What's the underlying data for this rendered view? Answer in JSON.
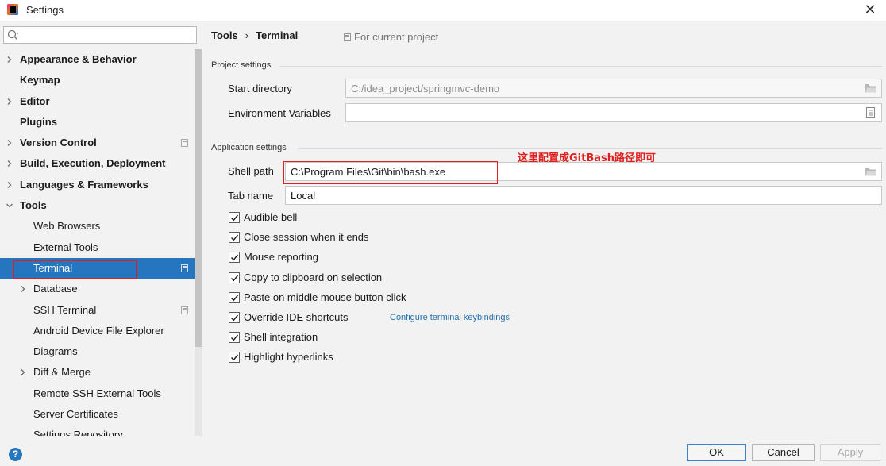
{
  "window": {
    "title": "Settings",
    "close_glyph": "✕"
  },
  "search": {
    "placeholder": "",
    "value": ""
  },
  "sidebar": {
    "items": [
      {
        "label": "Appearance & Behavior",
        "level": 0,
        "chevron": "right"
      },
      {
        "label": "Keymap",
        "level": 0,
        "chevron": "none"
      },
      {
        "label": "Editor",
        "level": 0,
        "chevron": "right"
      },
      {
        "label": "Plugins",
        "level": 0,
        "chevron": "none"
      },
      {
        "label": "Version Control",
        "level": 0,
        "chevron": "right",
        "project_icon": true
      },
      {
        "label": "Build, Execution, Deployment",
        "level": 0,
        "chevron": "right"
      },
      {
        "label": "Languages & Frameworks",
        "level": 0,
        "chevron": "right"
      },
      {
        "label": "Tools",
        "level": 0,
        "chevron": "down"
      },
      {
        "label": "Web Browsers",
        "level": 1,
        "chevron": "none"
      },
      {
        "label": "External Tools",
        "level": 1,
        "chevron": "none"
      },
      {
        "label": "Terminal",
        "level": 1,
        "chevron": "none",
        "selected": true,
        "project_icon": true
      },
      {
        "label": "Database",
        "level": 1,
        "chevron": "right"
      },
      {
        "label": "SSH Terminal",
        "level": 1,
        "chevron": "none",
        "project_icon": true
      },
      {
        "label": "Android Device File Explorer",
        "level": 1,
        "chevron": "none"
      },
      {
        "label": "Diagrams",
        "level": 1,
        "chevron": "none"
      },
      {
        "label": "Diff & Merge",
        "level": 1,
        "chevron": "right"
      },
      {
        "label": "Remote SSH External Tools",
        "level": 1,
        "chevron": "none"
      },
      {
        "label": "Server Certificates",
        "level": 1,
        "chevron": "none"
      },
      {
        "label": "Settings Repository",
        "level": 1,
        "chevron": "none"
      }
    ]
  },
  "breadcrumb": {
    "parent": "Tools",
    "separator": "›",
    "current": "Terminal"
  },
  "scope": {
    "label": "For current project"
  },
  "project_settings": {
    "title": "Project settings",
    "start_directory": {
      "label": "Start directory",
      "value": "C:/idea_project/springmvc-demo"
    },
    "env_vars": {
      "label": "Environment Variables",
      "value": ""
    }
  },
  "application_settings": {
    "title": "Application settings",
    "annotation": "这里配置成GitBash路径即可",
    "shell_path": {
      "label": "Shell path",
      "value": "C:\\Program Files\\Git\\bin\\bash.exe"
    },
    "tab_name": {
      "label": "Tab name",
      "value": "Local"
    },
    "checkboxes": [
      {
        "label": "Audible bell",
        "checked": true
      },
      {
        "label": "Close session when it ends",
        "checked": true
      },
      {
        "label": "Mouse reporting",
        "checked": true
      },
      {
        "label": "Copy to clipboard on selection",
        "checked": true
      },
      {
        "label": "Paste on middle mouse button click",
        "checked": true
      },
      {
        "label": "Override IDE shortcuts",
        "checked": true,
        "link": "Configure terminal keybindings"
      },
      {
        "label": "Shell integration",
        "checked": true
      },
      {
        "label": "Highlight hyperlinks",
        "checked": true
      }
    ]
  },
  "buttons": {
    "help": "?",
    "ok": "OK",
    "cancel": "Cancel",
    "apply": "Apply"
  },
  "colors": {
    "selection": "#2675bf",
    "annotation_red": "#e02020",
    "link": "#2470b3"
  }
}
